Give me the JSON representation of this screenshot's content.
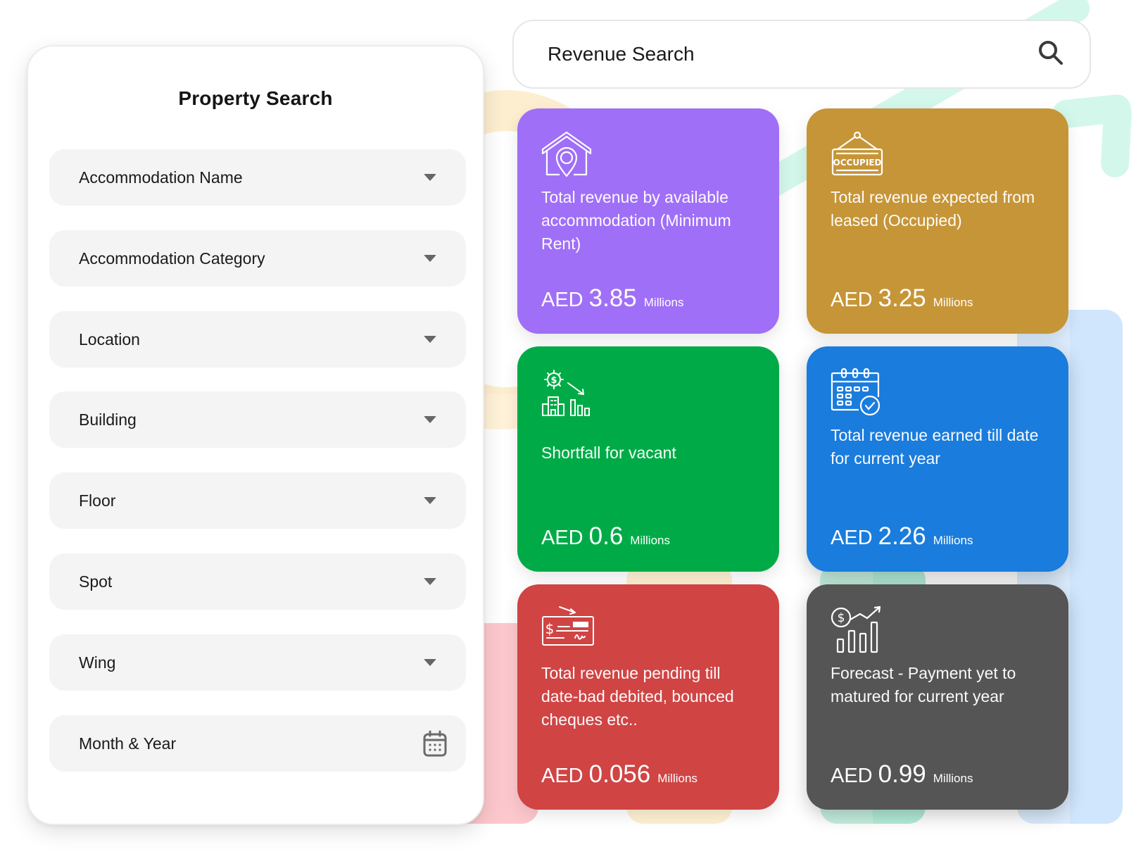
{
  "property_search": {
    "title": "Property Search",
    "fields": [
      {
        "label": "Accommodation Name",
        "control": "dropdown",
        "icon": "caret-down-icon"
      },
      {
        "label": "Accommodation Category",
        "control": "dropdown",
        "icon": "caret-down-icon"
      },
      {
        "label": "Location",
        "control": "dropdown",
        "icon": "caret-down-icon"
      },
      {
        "label": "Building",
        "control": "dropdown",
        "icon": "caret-down-icon"
      },
      {
        "label": "Floor",
        "control": "dropdown",
        "icon": "caret-down-icon"
      },
      {
        "label": "Spot",
        "control": "dropdown",
        "icon": "caret-down-icon"
      },
      {
        "label": "Wing",
        "control": "dropdown",
        "icon": "caret-down-icon"
      },
      {
        "label": "Month & Year",
        "control": "date-picker",
        "icon": "calendar-icon"
      }
    ]
  },
  "revenue_search": {
    "placeholder": "Revenue Search",
    "value": "",
    "icon": "search-icon"
  },
  "cards": [
    {
      "title": "Total revenue by available accommodation (Minimum Rent)",
      "currency": "AED",
      "value": "3.85",
      "unit": "Millions",
      "icon": "house-location-icon",
      "color": "#a06ff7"
    },
    {
      "title": "Total revenue expected from leased (Occupied)",
      "currency": "AED",
      "value": "3.25",
      "unit": "Millions",
      "icon": "occupied-sign-icon",
      "icon_text": "OCCUPIED",
      "color": "#c69537"
    },
    {
      "title": "Shortfall for vacant",
      "currency": "AED",
      "value": "0.6",
      "unit": "Millions",
      "icon": "revenue-decline-building-icon",
      "color": "#00ab47"
    },
    {
      "title": "Total revenue earned till date for current year",
      "currency": "AED",
      "value": "2.26",
      "unit": "Millions",
      "icon": "calendar-check-icon",
      "color": "#1a7cdc"
    },
    {
      "title": "Total revenue pending till date-bad debited, bounced cheques etc..",
      "currency": "AED",
      "value": "0.056",
      "unit": "Millions",
      "icon": "bounced-cheque-icon",
      "color": "#d04444"
    },
    {
      "title": "Forecast - Payment yet to matured for current year",
      "currency": "AED",
      "value": "0.99",
      "unit": "Millions",
      "icon": "forecast-growth-chart-icon",
      "color": "#555555"
    }
  ]
}
